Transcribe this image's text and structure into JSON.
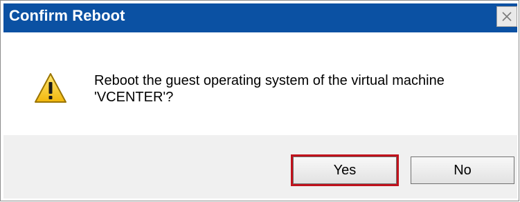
{
  "window": {
    "title": "Confirm Reboot",
    "close_icon": "close-icon"
  },
  "message": {
    "icon": "warning-icon",
    "line1": "Reboot the guest operating system of the virtual machine",
    "line2": "'VCENTER'?"
  },
  "buttons": {
    "yes_label": "Yes",
    "no_label": "No"
  },
  "colors": {
    "titlebar": "#0b51a3",
    "highlight": "#c0121c",
    "footer": "#f0f0f0"
  }
}
